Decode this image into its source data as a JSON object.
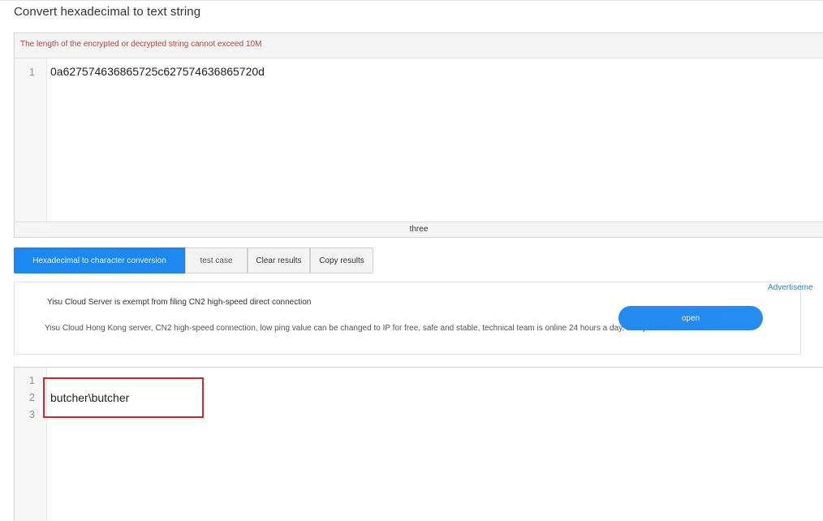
{
  "page": {
    "title": "Convert hexadecimal to text string"
  },
  "input_panel": {
    "notice": "The length of the encrypted or decrypted string cannot exceed 10M",
    "lines": [
      {
        "num": "1",
        "text": "0a627574636865725c627574636865720d"
      }
    ],
    "status": "three"
  },
  "buttons": {
    "convert": "Hexadecimal to character conversion",
    "test_case": "test case",
    "clear": "Clear results",
    "copy": "Copy results"
  },
  "ad": {
    "label": "Advertiseme",
    "title": "Yisu Cloud Server is exempt from filing CN2 high-speed direct connection",
    "description": "Yisu Cloud Hong Kong server, CN2 high-speed connection, low ping value can be changed to IP for free, safe and stable, technical team is online 24 hours a day, worry free Yisu Cloud",
    "open_label": "open",
    "accent_color": "#1e88f1"
  },
  "output_panel": {
    "lines": [
      {
        "num": "1",
        "text": ""
      },
      {
        "num": "2",
        "text": "butcher\\butcher"
      },
      {
        "num": "3",
        "text": ""
      }
    ],
    "highlight_color": "#d7262b"
  }
}
